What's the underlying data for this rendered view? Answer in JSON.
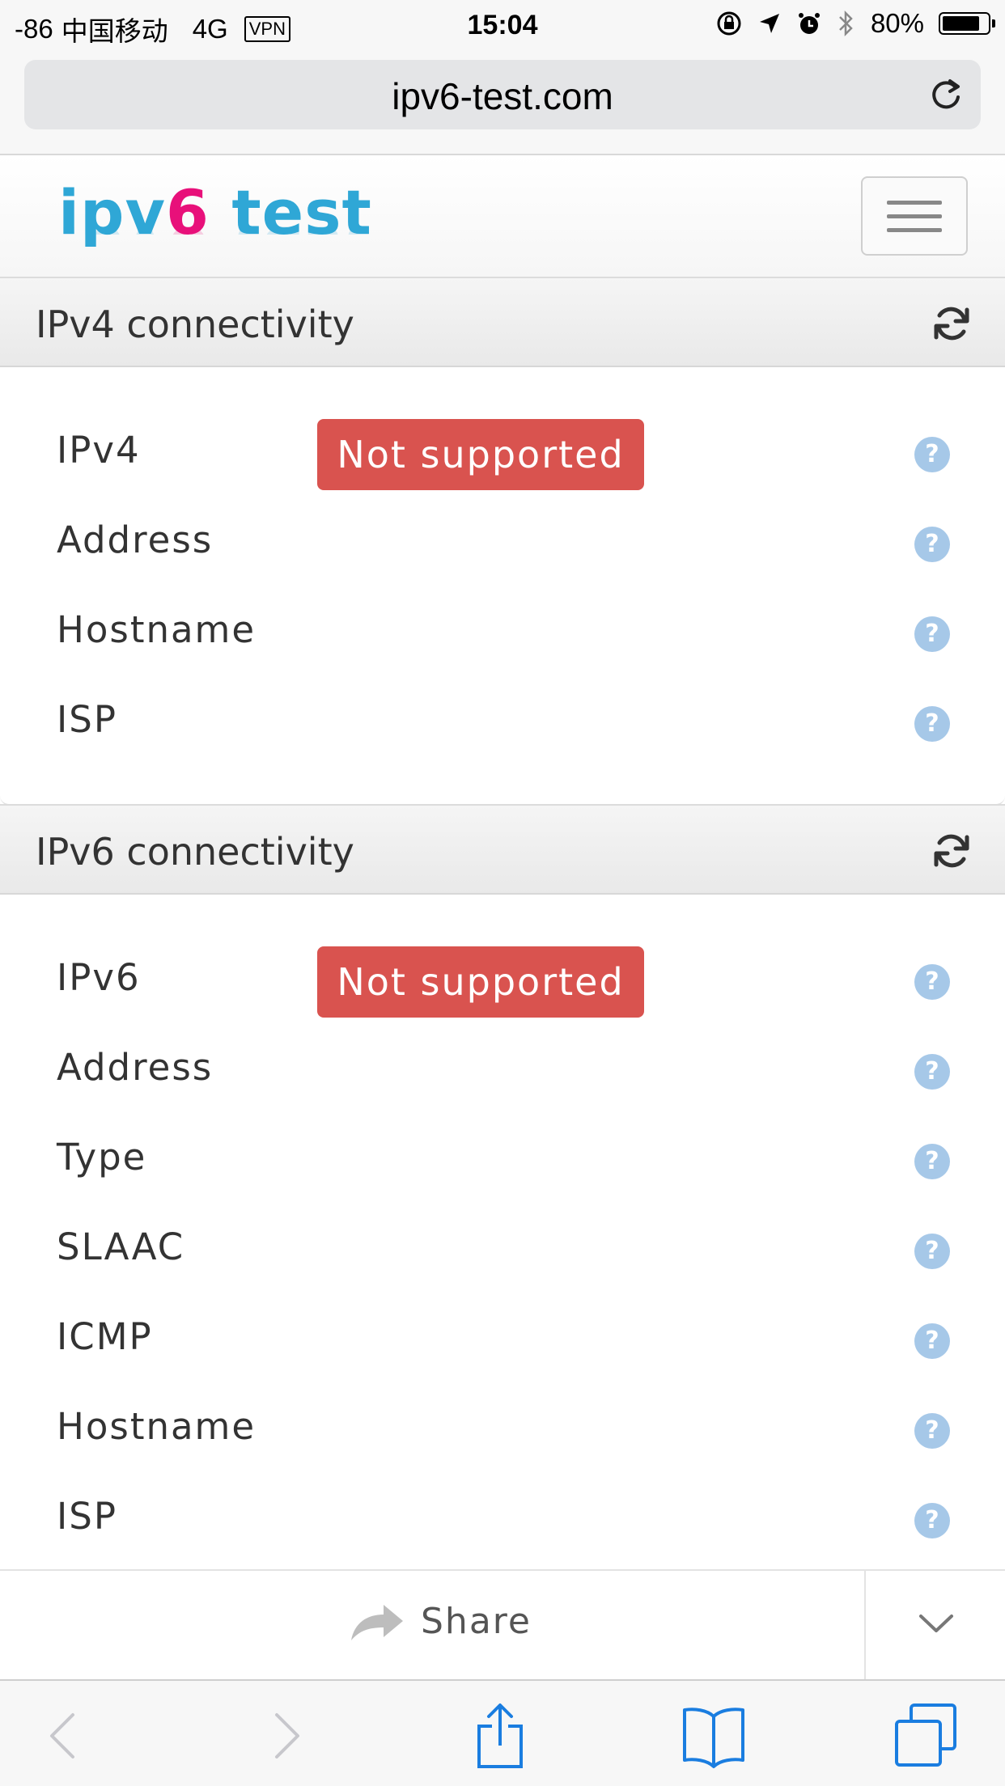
{
  "status_bar": {
    "signal": "-86",
    "carrier": "中国移动",
    "network": "4G",
    "vpn": "VPN",
    "time": "15:04",
    "battery": "80%",
    "battery_level": 0.8
  },
  "browser": {
    "url": "ipv6-test.com"
  },
  "site": {
    "logo_part1": "ipv",
    "logo_part2": "6",
    "logo_part3": " test"
  },
  "ipv4_panel": {
    "title": "IPv4 connectivity",
    "rows": [
      {
        "label": "IPv4",
        "badge": "Not supported"
      },
      {
        "label": "Address"
      },
      {
        "label": "Hostname"
      },
      {
        "label": "ISP"
      }
    ]
  },
  "ipv6_panel": {
    "title": "IPv6 connectivity",
    "rows": [
      {
        "label": "IPv6",
        "badge": "Not supported"
      },
      {
        "label": "Address"
      },
      {
        "label": "Type"
      },
      {
        "label": "SLAAC"
      },
      {
        "label": "ICMP"
      },
      {
        "label": "Hostname"
      },
      {
        "label": "ISP"
      }
    ]
  },
  "share_bar": {
    "share_label": "Share"
  },
  "icons": {
    "help": "?",
    "help_color": "#a6c8e8",
    "badge_color": "#d9534f",
    "toolbar_accent": "#1a7de0"
  }
}
